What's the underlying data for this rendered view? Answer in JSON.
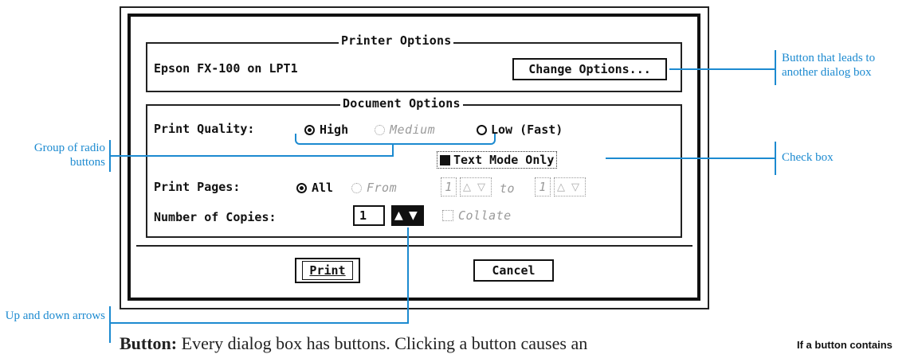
{
  "dialog": {
    "printer_options": {
      "legend": "Printer Options",
      "printer_name": "Epson FX-100 on LPT1",
      "change_options_label": "Change Options..."
    },
    "document_options": {
      "legend": "Document Options",
      "print_quality_label": "Print Quality:",
      "quality_high": "High",
      "quality_medium": "Medium",
      "quality_low": "Low (Fast)",
      "text_mode_label": "Text Mode Only",
      "print_pages_label": "Print Pages:",
      "pages_all": "All",
      "pages_from": "From",
      "from_value": "1",
      "to_label": "to",
      "to_value": "1",
      "copies_label": "Number of Copies:",
      "copies_value": "1",
      "collate_label": "Collate"
    },
    "print_button": "Print",
    "cancel_button": "Cancel"
  },
  "annotations": {
    "button_dialog": "Button that leads to another dialog box",
    "radio_group": "Group of radio buttons",
    "check_box": "Check box",
    "up_down_arrows": "Up and down arrows"
  },
  "page_text": {
    "body_bold": "Button:",
    "body_rest": " Every dialog box has buttons. Clicking a button causes an",
    "side_note": "If a button contains"
  },
  "colors": {
    "callout": "#1c8ad0",
    "frame": "#111111"
  }
}
